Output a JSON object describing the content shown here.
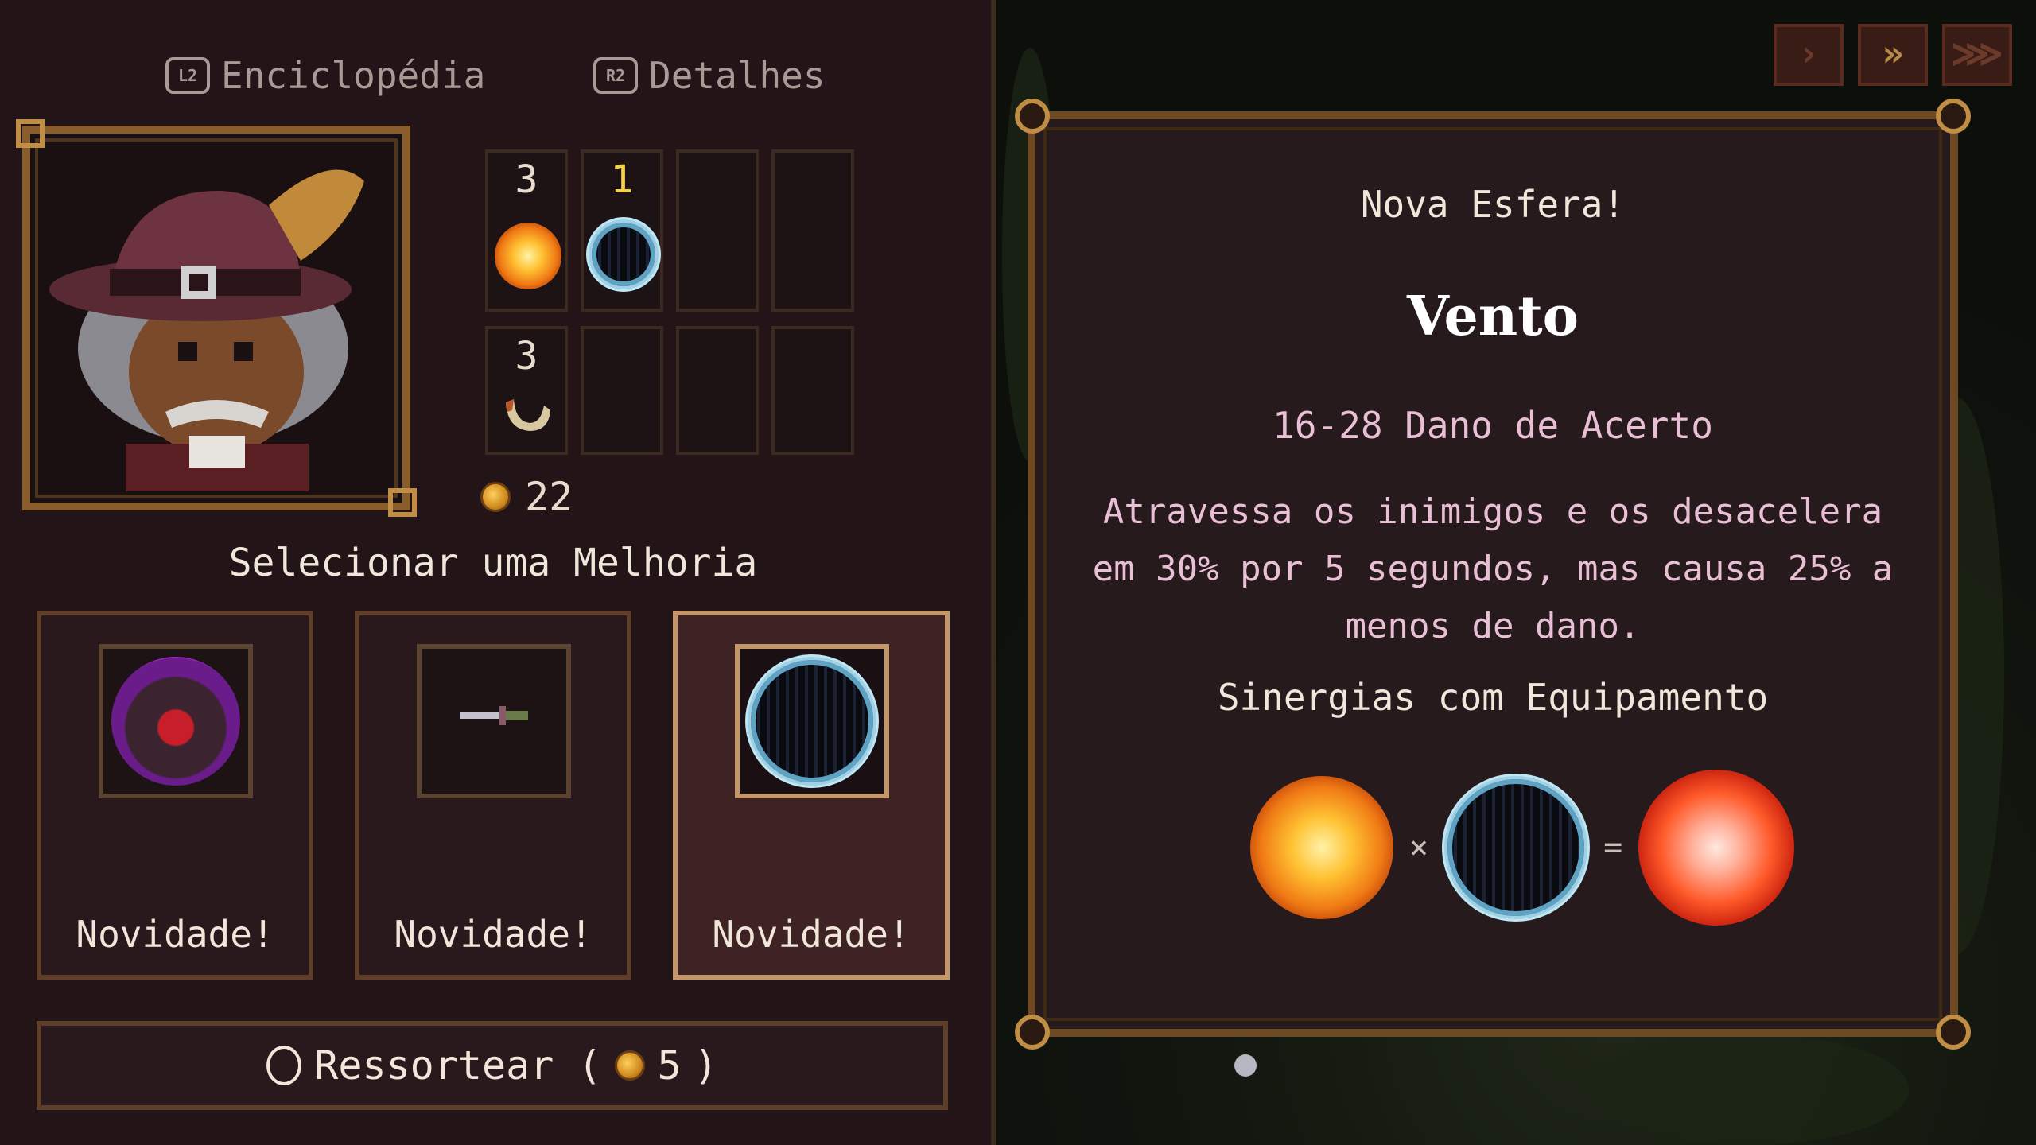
{
  "tabs": [
    {
      "button": "L2",
      "label": "Enciclopédia"
    },
    {
      "button": "R2",
      "label": "Detalhes"
    }
  ],
  "speed_controls": [
    {
      "icon": "speed-1x-icon",
      "symbol": "›"
    },
    {
      "icon": "speed-2x-icon",
      "symbol": "»"
    },
    {
      "icon": "speed-3x-icon",
      "symbol": "⋙"
    }
  ],
  "inventory": {
    "slots": [
      {
        "count": "3",
        "item": "fire-orb-icon",
        "count_color": "#e9dccc"
      },
      {
        "count": "1",
        "item": "wind-orb-icon",
        "count_color": "#f1d24a"
      },
      {
        "count": "",
        "item": ""
      },
      {
        "count": "",
        "item": ""
      },
      {
        "count": "3",
        "item": "horn-icon"
      },
      {
        "count": "",
        "item": ""
      },
      {
        "count": "",
        "item": ""
      },
      {
        "count": "",
        "item": ""
      }
    ],
    "gold": "22"
  },
  "upgrade": {
    "title": "Selecionar uma Melhoria",
    "cards": [
      {
        "label": "Novidade!",
        "icon": "curse-orb-icon",
        "selected": false
      },
      {
        "label": "Novidade!",
        "icon": "dagger-icon",
        "selected": false
      },
      {
        "label": "Novidade!",
        "icon": "wind-orb-icon",
        "selected": true
      }
    ],
    "reroll": {
      "label": "Ressortear (",
      "cost": "5",
      "close": ")"
    }
  },
  "details": {
    "header": "Nova Esfera!",
    "name": "Vento",
    "damage": "16-28 Dano de Acerto",
    "description": "Atravessa os inimigos e os desacelera em 30% por 5 segundos, mas causa 25% a menos de dano.",
    "synergy_title": "Sinergias com Equipamento",
    "synergy": {
      "op1": "×",
      "op2": "="
    }
  },
  "colors": {
    "panel_bg": "#221417",
    "frame_gold": "#c08d45",
    "text_pink": "#e8bfd4",
    "selected_border": "#c4976a"
  }
}
